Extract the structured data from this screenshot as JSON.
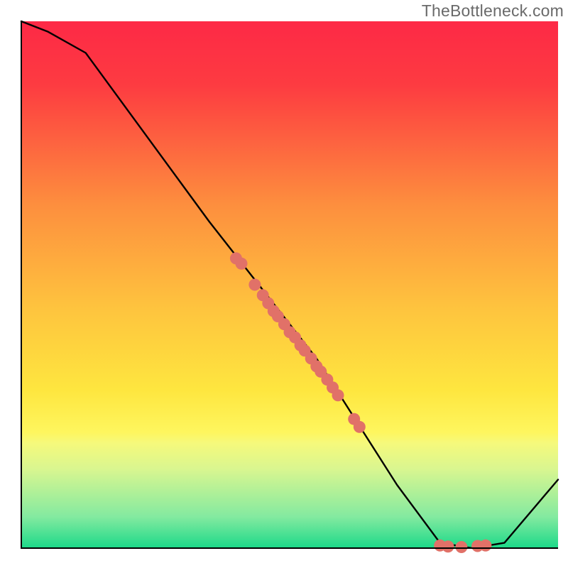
{
  "watermark": "TheBottleneck.com",
  "chart_data": {
    "type": "line",
    "title": "",
    "xlabel": "",
    "ylabel": "",
    "xlim": [
      0,
      100
    ],
    "ylim": [
      0,
      100
    ],
    "background_gradient": {
      "top": "#fd2946",
      "mid": "#fee63f",
      "band": "#d9f690",
      "bottom": "#1cd989"
    },
    "series": [
      {
        "name": "curve",
        "x": [
          0,
          5,
          12,
          35,
          55,
          70,
          78,
          84,
          90,
          100
        ],
        "y": [
          100,
          98,
          94,
          62,
          36,
          12,
          1,
          0,
          1,
          13
        ]
      }
    ],
    "points": {
      "name": "highlight-dots",
      "color": "#e17168",
      "xy": [
        [
          40,
          55
        ],
        [
          41,
          54
        ],
        [
          43.5,
          50
        ],
        [
          45,
          48
        ],
        [
          46,
          46.5
        ],
        [
          47,
          45
        ],
        [
          47.8,
          44
        ],
        [
          49,
          42.5
        ],
        [
          50,
          41
        ],
        [
          51,
          40
        ],
        [
          52,
          38.5
        ],
        [
          52.8,
          37.5
        ],
        [
          54,
          36
        ],
        [
          55,
          34.5
        ],
        [
          55.8,
          33.5
        ],
        [
          57,
          32
        ],
        [
          58,
          30.5
        ],
        [
          59,
          29
        ],
        [
          62,
          24.5
        ],
        [
          63,
          23
        ],
        [
          78,
          0.5
        ],
        [
          79.5,
          0.3
        ],
        [
          82,
          0.2
        ],
        [
          85,
          0.4
        ],
        [
          86.5,
          0.5
        ]
      ]
    }
  }
}
